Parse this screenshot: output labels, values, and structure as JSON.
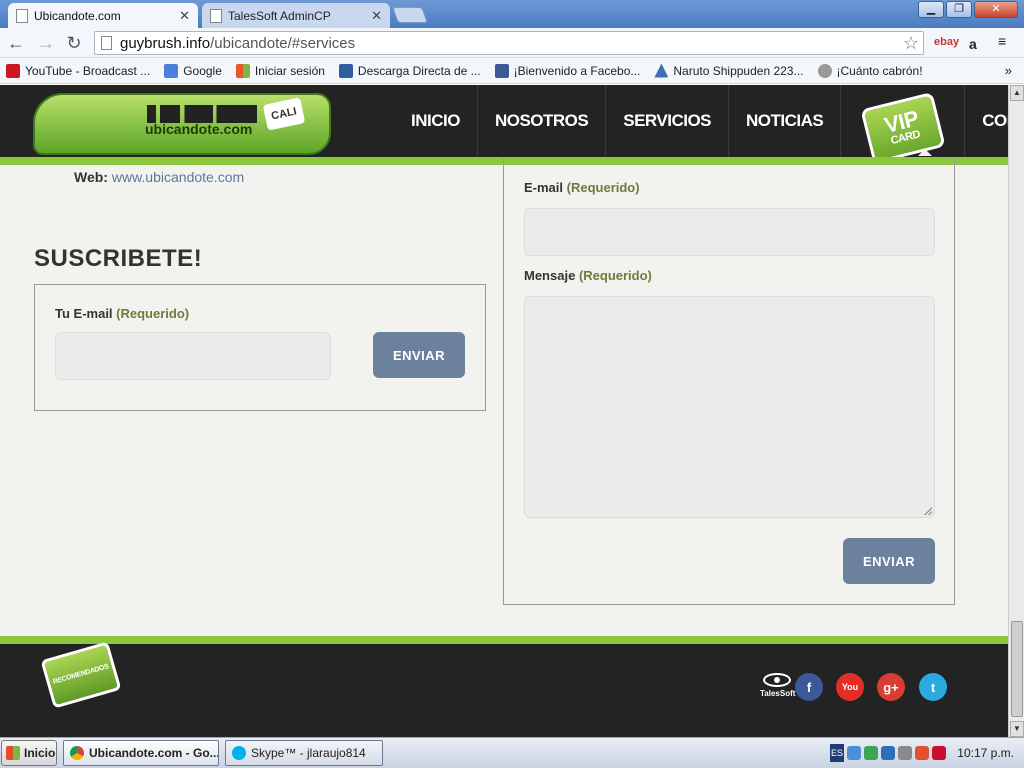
{
  "browser": {
    "tabs": [
      {
        "title": "Ubicandote.com",
        "active": true
      },
      {
        "title": "TalesSoft AdminCP",
        "active": false
      }
    ],
    "url_host": "guybrush.info",
    "url_path": "/ubicandote/#services",
    "extensions": [
      "ebay",
      "a"
    ],
    "bookmarks": [
      {
        "label": "YouTube - Broadcast ...",
        "icon": "youtube-icon",
        "color": "#cc181e"
      },
      {
        "label": "Google",
        "icon": "google-icon",
        "color": "#4a7fe0"
      },
      {
        "label": "Iniciar sesión",
        "icon": "windows-icon",
        "color": "#e8562a"
      },
      {
        "label": "Descarga Directa de ...",
        "icon": "t-icon",
        "color": "#2f5f9e"
      },
      {
        "label": "¡Bienvenido a Facebo...",
        "icon": "facebook-icon",
        "color": "#3b5998"
      },
      {
        "label": "Naruto Shippuden 223...",
        "icon": "triangle-icon",
        "color": "#3d6fb6"
      },
      {
        "label": "¡Cuánto cabrón!",
        "icon": "meme-face-icon",
        "color": "#999999"
      }
    ],
    "bookmarks_more": "»"
  },
  "site": {
    "logo_text": "ubicandote.com",
    "logo_badge": "CALI",
    "nav": [
      "INICIO",
      "NOSOTROS",
      "SERVICIOS",
      "NOTICIAS",
      "CONTACTO"
    ],
    "vip": {
      "title": "VIP",
      "subtitle": "Card"
    },
    "web_label": "Web:",
    "web_url": "www.ubicandote.com",
    "subscribe": {
      "title": "SUSCRIBETE!",
      "email_label": "Tu E-mail",
      "required": "(Requerido)",
      "button": "ENVIAR"
    },
    "contact": {
      "email_label": "E-mail",
      "message_label": "Mensaje",
      "required": "(Requerido)",
      "button": "ENVIAR"
    },
    "footer": {
      "recommended": "RECOMENDADOS",
      "talessoft": "TalesSoft",
      "social": [
        {
          "name": "facebook",
          "glyph": "f",
          "color": "#3b5998"
        },
        {
          "name": "youtube",
          "glyph": "You",
          "color": "#e52d27"
        },
        {
          "name": "google-plus",
          "glyph": "g+",
          "color": "#d73d32"
        },
        {
          "name": "twitter",
          "glyph": "t",
          "color": "#2ba9e1"
        }
      ]
    },
    "colors": {
      "accent": "#8cc63f",
      "header": "#232323",
      "button": "#6c819e",
      "required": "#6b7d3b"
    }
  },
  "taskbar": {
    "start": "Inicio",
    "tasks": [
      {
        "label": "Ubicandote.com - Go...",
        "icon": "chrome-icon"
      },
      {
        "label": "Skype™ - jlaraujo814",
        "icon": "skype-icon"
      }
    ],
    "lang": "ES",
    "clock": "10:17 p.m."
  }
}
